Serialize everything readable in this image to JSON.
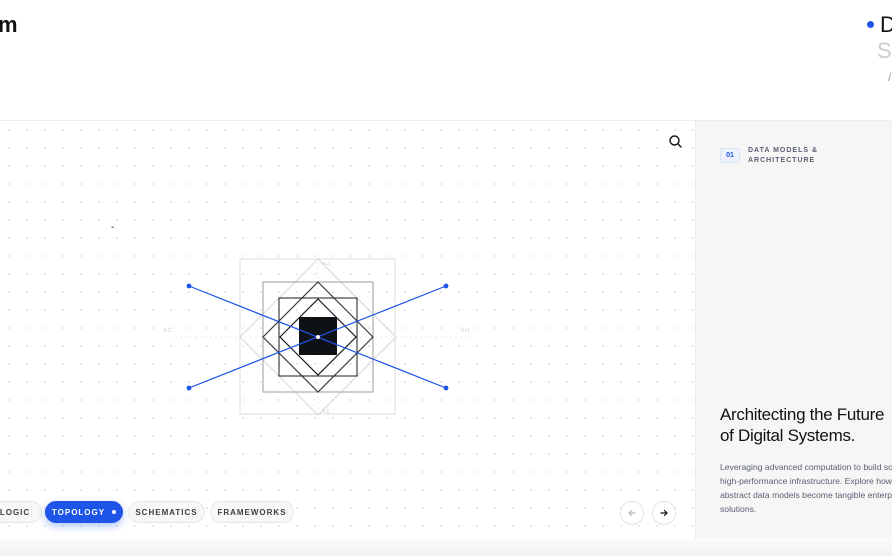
{
  "brand": {
    "text": "m"
  },
  "nav": {
    "active_label": "D",
    "next_label": "S",
    "tick": "/"
  },
  "canvas": {
    "stray_mark": "-",
    "icons": {
      "search": "search-icon",
      "prev": "arrow-left-icon",
      "next": "arrow-right-icon"
    }
  },
  "chips": [
    {
      "label": "LOGIC",
      "active": false
    },
    {
      "label": "TOPOLOGY",
      "active": true
    },
    {
      "label": "SCHEMATICS",
      "active": false
    },
    {
      "label": "FRAMEWORKS",
      "active": false
    }
  ],
  "diagram": {
    "axis_labels": {
      "top": "Y+1",
      "bottom": "Y-1",
      "left": "X-1",
      "right": "X+1"
    }
  },
  "sidebar": {
    "index": "01",
    "label": "DATA MODELS & ARCHITECTURE",
    "headline_line1": "Architecting the Future",
    "headline_line2": "of Digital Systems.",
    "body": "Leveraging advanced computation to build scalable, high-performance infrastructure. Explore how abstract data models become tangible enterprise solutions."
  },
  "colors": {
    "accent": "#1d55e8",
    "ink": "#111827",
    "muted": "#5a6070",
    "panel": "#f6f6f7"
  }
}
